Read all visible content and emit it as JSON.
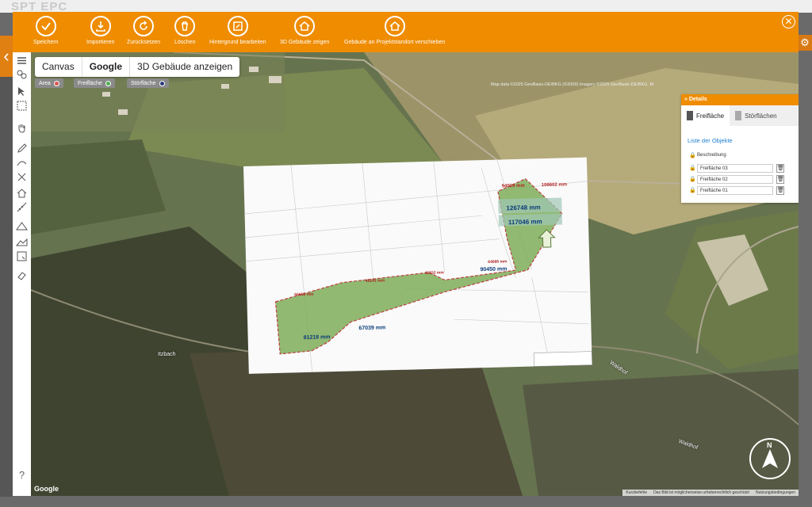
{
  "background": {
    "logo_text": "SPT EPC",
    "left_arrow": "‹",
    "right_icon": "⚙"
  },
  "toolbar": {
    "buttons": [
      {
        "label": "Speichern",
        "icon": "check-icon"
      },
      {
        "label": "Importieren",
        "icon": "import-icon"
      },
      {
        "label": "Zurücksetzen",
        "icon": "reset-icon"
      },
      {
        "label": "Löschen",
        "icon": "trash-icon"
      },
      {
        "label": "Hintergrund bearbeiten",
        "icon": "edit-background-icon"
      },
      {
        "label": "3D Gebäude zeigen",
        "icon": "home-icon"
      },
      {
        "label": "Gebäude an Projektstandort verschieben",
        "icon": "home-move-icon"
      }
    ],
    "close": "✕"
  },
  "map_tabs": [
    {
      "label": "Canvas",
      "active": false
    },
    {
      "label": "Google",
      "active": true
    },
    {
      "label": "3D Gebäude anzeigen",
      "active": false
    }
  ],
  "legend": [
    {
      "label": "Area",
      "color": "#d9534f"
    },
    {
      "label": "Freifläche",
      "color": "#4caf50"
    },
    {
      "label": "Störfläche",
      "color": "#2b3a7a"
    }
  ],
  "map_credit": "Map data ©2025 GeoBasis-DE/BKG (©2009) Imagery ©2025 GeoBasis-DE/BKG, M",
  "google_logo": "Google",
  "bottom_credits": [
    "Kurzbefehle",
    "Das Bild ist möglicherweise urheberrechtlich geschützt",
    "Nutzungsbedingungen"
  ],
  "place_labels": [
    "Itzbach",
    "Waldhof",
    "Waldhof"
  ],
  "plan_labels": [
    "56658 mm",
    "45241 mm",
    "42832 mm",
    "64686 mm",
    "90450 mm",
    "126748 mm",
    "117046 mm",
    "89316 mm",
    "94029 mm",
    "106602 mm",
    "67472 mm",
    "93716 mm",
    "81218 mm",
    "67039 mm"
  ],
  "north_label": "N",
  "help": "?",
  "details": {
    "title": "Details",
    "tabs": [
      "Freifläche",
      "Störflächen"
    ],
    "list_title": "Liste der Objekte",
    "column": "Beschreibung",
    "items": [
      "Freifläche 03",
      "Freifläche 02",
      "Freifläche 01"
    ]
  }
}
